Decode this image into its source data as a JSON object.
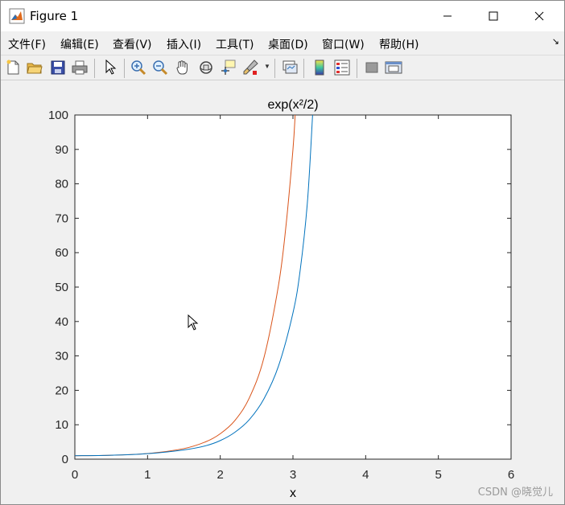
{
  "window": {
    "title": "Figure 1"
  },
  "menu": {
    "items": [
      "文件(F)",
      "编辑(E)",
      "查看(V)",
      "插入(I)",
      "工具(T)",
      "桌面(D)",
      "窗口(W)",
      "帮助(H)"
    ]
  },
  "toolbar": {
    "icons": [
      "new-figure-icon",
      "open-file-icon",
      "save-icon",
      "print-icon",
      "select-arrow-icon",
      "zoom-in-icon",
      "zoom-out-icon",
      "pan-hand-icon",
      "rotate-3d-icon",
      "data-cursor-icon",
      "brush-icon",
      "link-plot-icon",
      "colorbar-icon",
      "legend-icon",
      "hide-plot-tools-icon",
      "show-plot-tools-icon"
    ]
  },
  "watermark": "CSDN @晓觉儿",
  "colors": {
    "series1": "#0072BD",
    "series2": "#D95319"
  },
  "chart_data": {
    "type": "line",
    "title": "exp(x²/2)",
    "xlabel": "x",
    "ylabel": "",
    "xlim": [
      0,
      6
    ],
    "ylim": [
      0,
      100
    ],
    "xticks": [
      "0",
      "1",
      "2",
      "3",
      "4",
      "5",
      "6"
    ],
    "yticks": [
      "0",
      "10",
      "20",
      "30",
      "40",
      "50",
      "60",
      "70",
      "80",
      "90",
      "100"
    ],
    "grid": false,
    "series": [
      {
        "color": "#D95319",
        "x": [
          0,
          0.5,
          1,
          1.5,
          1.8,
          2,
          2.2,
          2.4,
          2.6,
          2.8,
          2.9,
          3.0,
          3.03
        ],
        "y": [
          1,
          1.13,
          1.65,
          3.08,
          5.05,
          7.39,
          11.2,
          17.8,
          29.4,
          50.4,
          67.0,
          90.0,
          100
        ]
      },
      {
        "color": "#0072BD",
        "x": [
          0,
          0.5,
          1,
          1.5,
          1.8,
          2,
          2.2,
          2.4,
          2.6,
          2.8,
          3.0,
          3.1,
          3.2,
          3.27
        ],
        "y": [
          1,
          1.13,
          1.6,
          2.7,
          3.9,
          5.4,
          7.8,
          11.5,
          17.5,
          27.0,
          42.5,
          55.0,
          75.0,
          100
        ]
      }
    ]
  }
}
